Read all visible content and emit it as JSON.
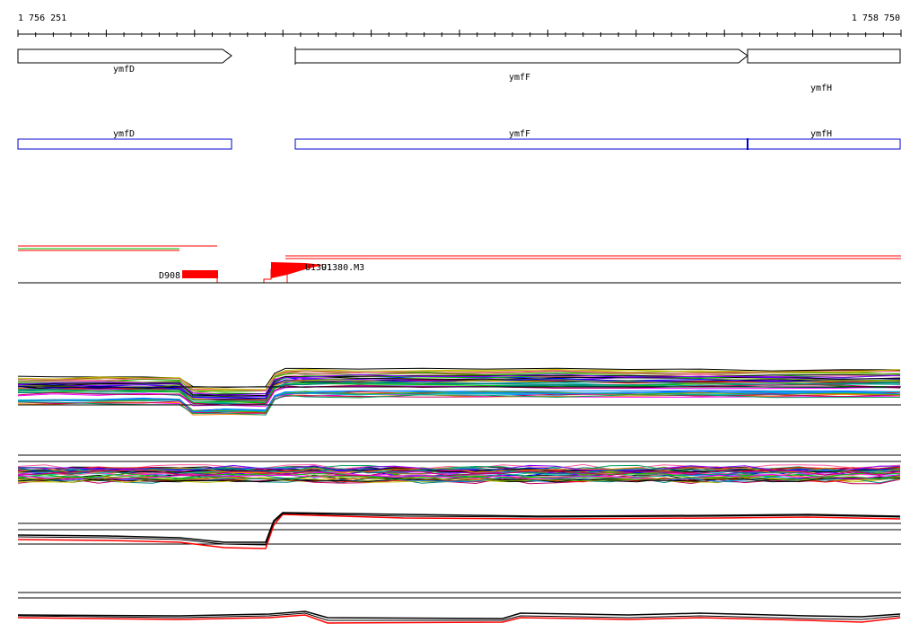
{
  "ruler": {
    "start_label": "1 756 251",
    "end_label": "1 758 750"
  },
  "genes": [
    {
      "name": "ymfD"
    },
    {
      "name": "ymfF"
    },
    {
      "name": "ymfH"
    }
  ],
  "cds": [
    {
      "name": "ymfD"
    },
    {
      "name": "ymfF"
    },
    {
      "name": "ymfH"
    }
  ],
  "features": {
    "left_label": "D908",
    "right_label_a": "U1391",
    "right_label_b": "U1380.M3"
  },
  "colors": {
    "cds_outline": "#0000cc",
    "feature": "#ff0000",
    "axis": "#000000"
  },
  "palette": [
    "#ff0000",
    "#00c000",
    "#0000ff",
    "#ff00ff",
    "#00c0c0",
    "#c0c000",
    "#ff8000",
    "#8000ff",
    "#008080",
    "#c00060",
    "#60a000",
    "#0080ff",
    "#a05000",
    "#ff60a0",
    "#00a060"
  ]
}
